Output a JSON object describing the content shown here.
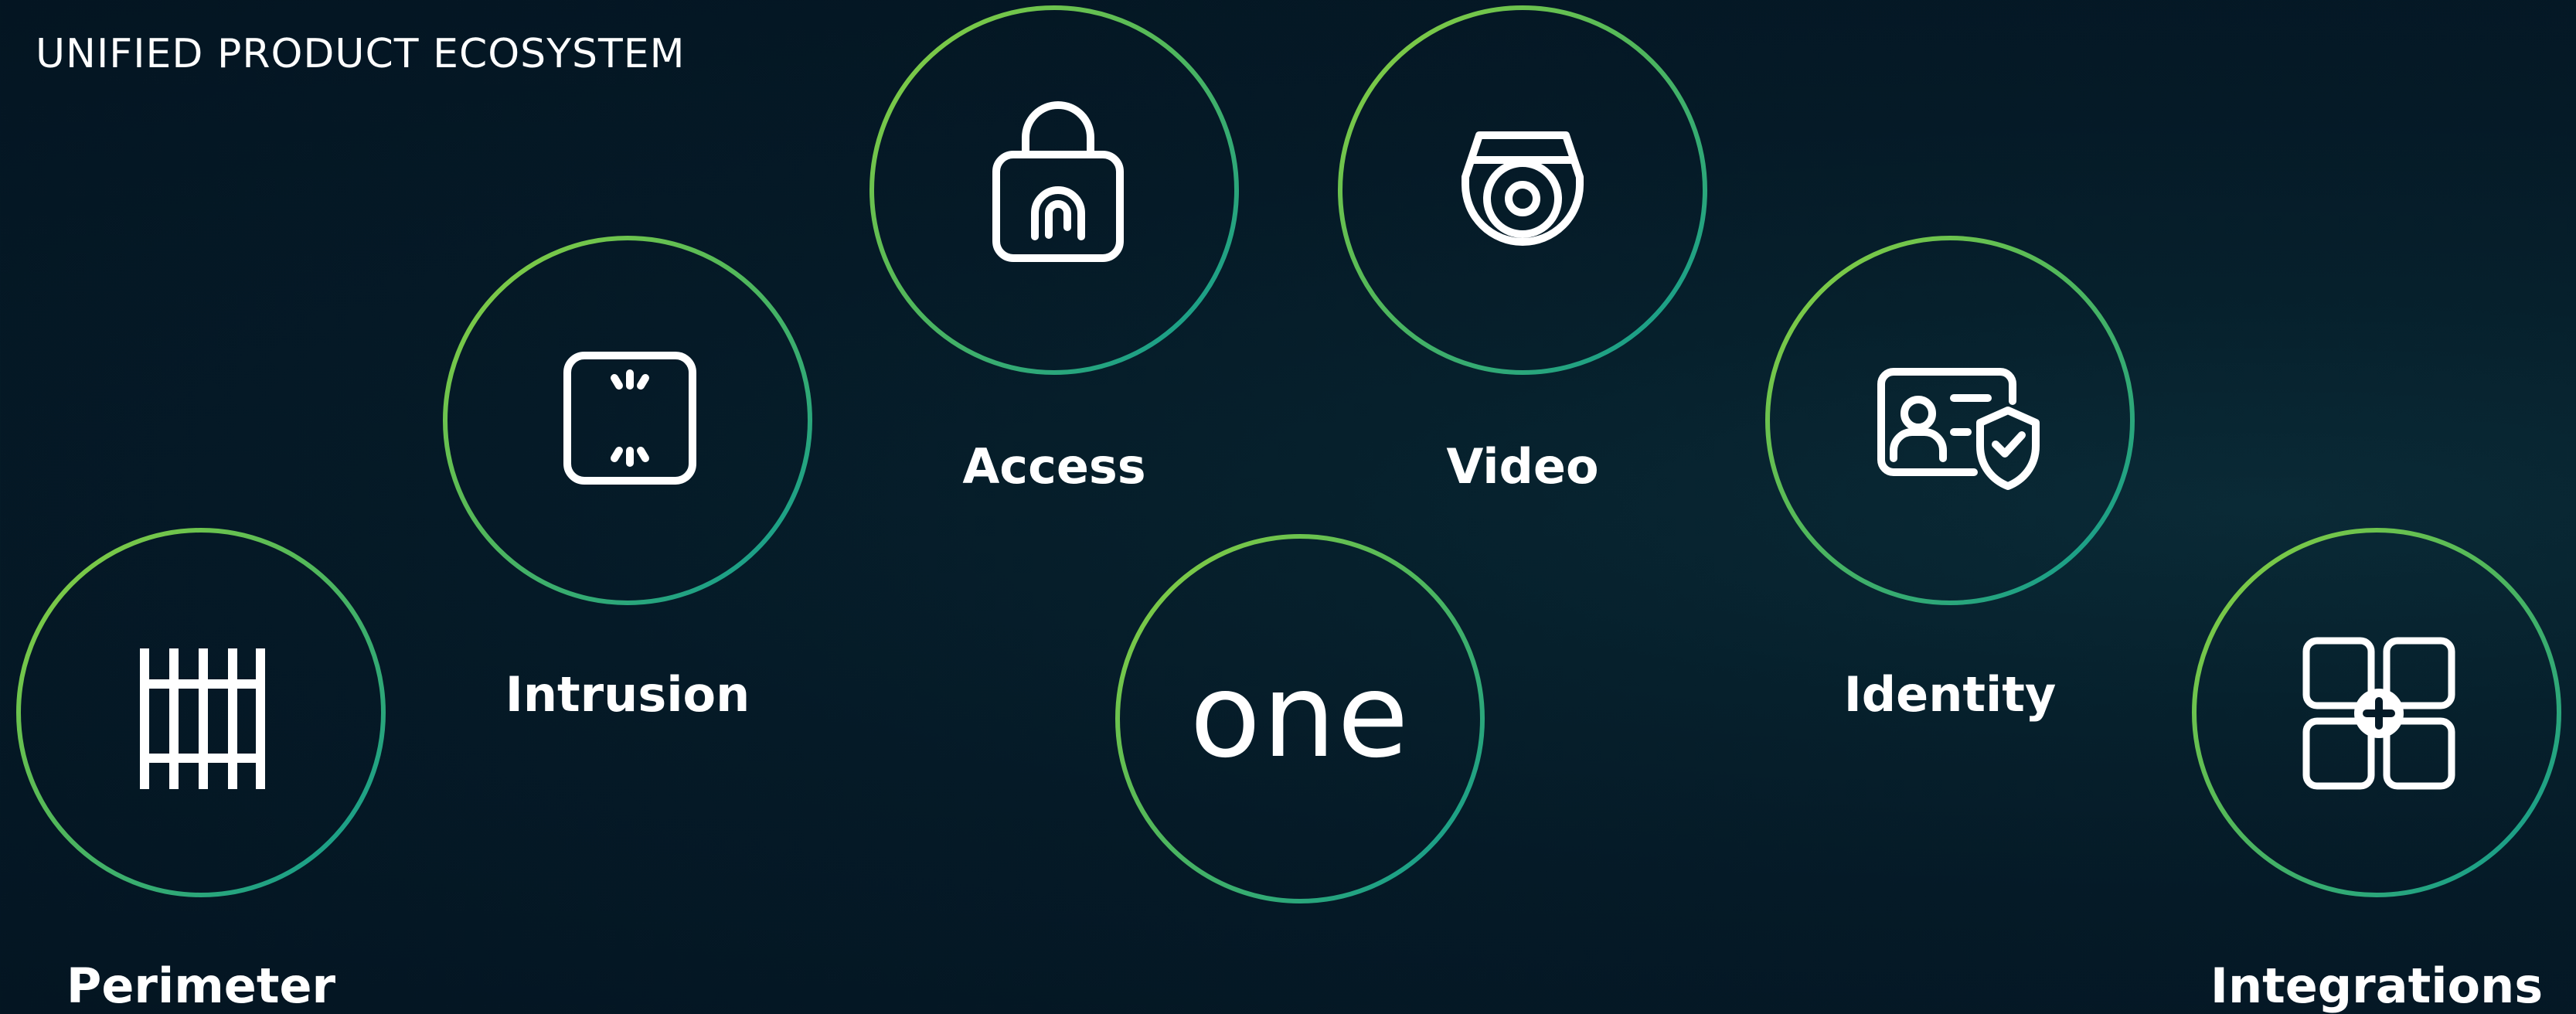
{
  "title": "UNIFIED PRODUCT ECOSYSTEM",
  "colors": {
    "ring_start": "#7ac843",
    "ring_end": "#0b9a94",
    "icon": "#ffffff",
    "background": "#051a27"
  },
  "hub": {
    "text": "one",
    "name": "one-hub"
  },
  "products": [
    {
      "key": "perimeter",
      "label": "Perimeter",
      "icon": "fence-icon"
    },
    {
      "key": "intrusion",
      "label": "Intrusion",
      "icon": "motion-sensor-icon"
    },
    {
      "key": "access",
      "label": "Access",
      "icon": "fingerprint-lock-icon"
    },
    {
      "key": "video",
      "label": "Video",
      "icon": "dome-camera-icon"
    },
    {
      "key": "identity",
      "label": "Identity",
      "icon": "id-card-shield-icon"
    },
    {
      "key": "integrations",
      "label": "Integrations",
      "icon": "integrations-grid-icon"
    }
  ]
}
